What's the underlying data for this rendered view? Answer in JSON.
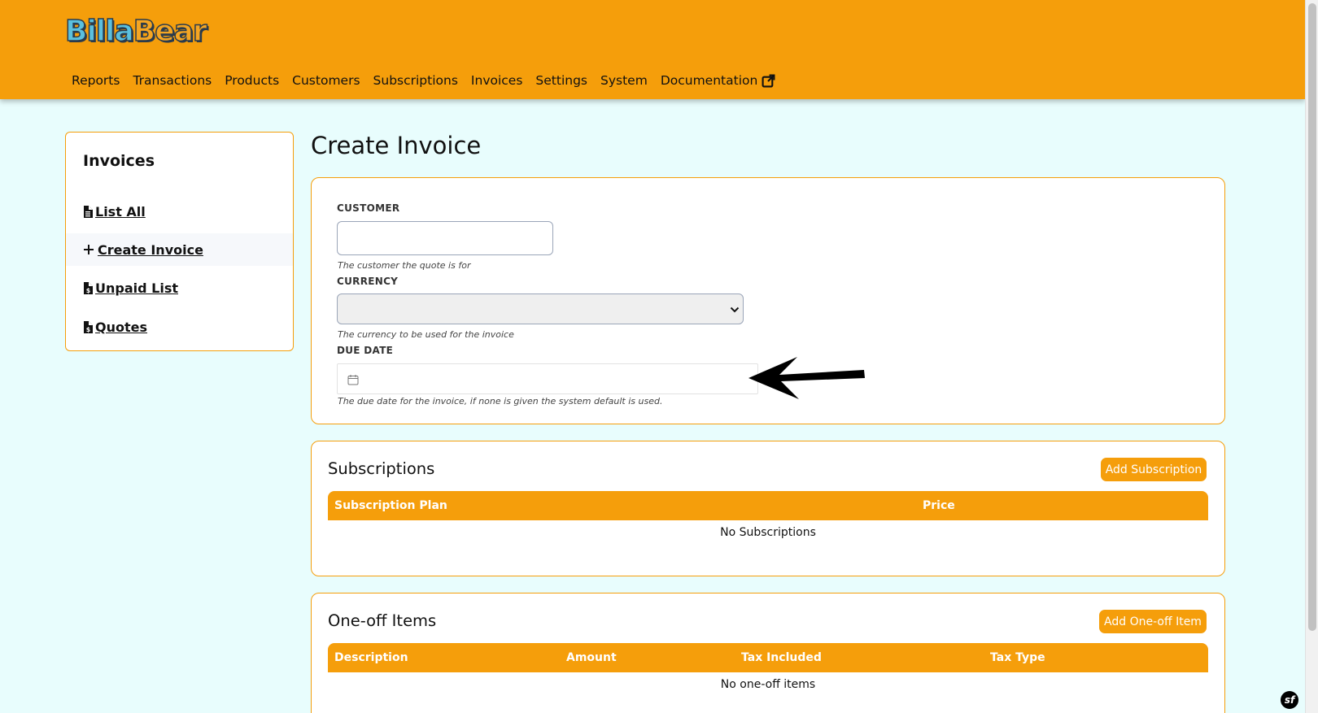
{
  "brand": {
    "logo_part1": "Billa",
    "logo_part2": "Bear"
  },
  "nav": {
    "items": [
      "Reports",
      "Transactions",
      "Products",
      "Customers",
      "Subscriptions",
      "Invoices",
      "Settings",
      "System",
      "Documentation"
    ]
  },
  "sidebar": {
    "title": "Invoices",
    "items": [
      {
        "label": "List All",
        "icon": "file-icon"
      },
      {
        "label": "Create Invoice",
        "icon": "plus-icon",
        "active": true
      },
      {
        "label": "Unpaid List",
        "icon": "file-dollar-icon"
      },
      {
        "label": "Quotes",
        "icon": "file-dollar-icon"
      }
    ]
  },
  "page": {
    "title": "Create Invoice"
  },
  "form": {
    "customer": {
      "label": "CUSTOMER",
      "value": "",
      "help": "The customer the quote is for"
    },
    "currency": {
      "label": "CURRENCY",
      "value": "",
      "help": "The currency to be used for the invoice"
    },
    "due_date": {
      "label": "DUE DATE",
      "value": "",
      "help": "The due date for the invoice, if none is given the system default is used."
    }
  },
  "subscriptions": {
    "title": "Subscriptions",
    "add_label": "Add Subscription",
    "columns": [
      "Subscription Plan",
      "Price"
    ],
    "empty": "No Subscriptions"
  },
  "one_off": {
    "title": "One-off Items",
    "add_label": "Add One-off Item",
    "columns": [
      "Description",
      "Amount",
      "Tax Included",
      "Tax Type"
    ],
    "empty": "No one-off items"
  },
  "colors": {
    "accent": "#f59e0b",
    "background": "#e8fdfd"
  },
  "debug_badge": "sf"
}
